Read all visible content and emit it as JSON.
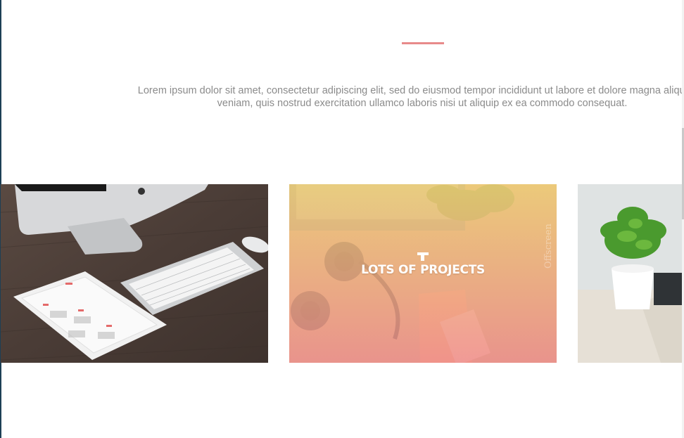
{
  "intro": {
    "line1": "Lorem ipsum dolor sit amet, consectetur adipiscing elit, sed do eiusmod tempor incididunt ut labore et dolore magna aliqua. Ut",
    "line2": "veniam, quis nostrud exercitation ullamco laboris nisi ut aliquip ex ea commodo consequat."
  },
  "gallery": {
    "items": [
      {
        "image": "desk-imac-keyboard-ipad"
      },
      {
        "image": "headphones-notebook-phone",
        "overlay_title": "LOTS OF PROJECTS"
      },
      {
        "image": "potted-plant"
      }
    ]
  },
  "colors": {
    "accent": "#e88a8a",
    "text_muted": "#8b8b8b",
    "overlay_top": "#f3d27a",
    "overlay_bottom": "#f09090"
  }
}
